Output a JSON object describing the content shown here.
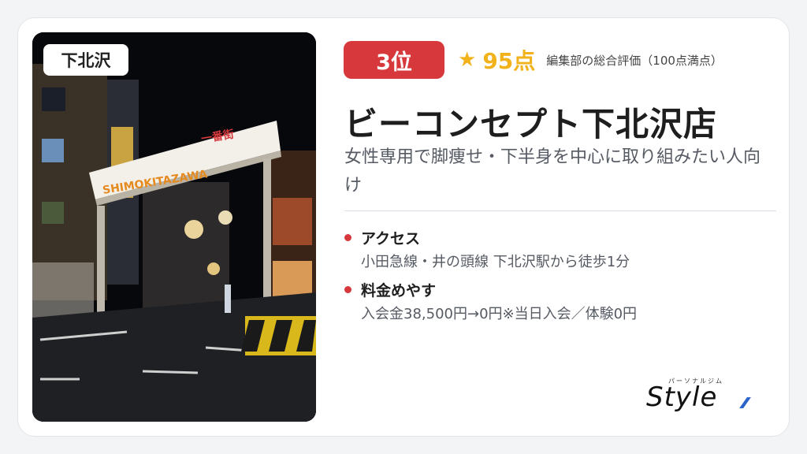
{
  "card": {
    "area_tag": "下北沢",
    "rank_label": "3位",
    "score_label": "95点",
    "score_note": "編集部の総合評価（100点満点）",
    "shop_name": "ビーコンセプト下北沢店",
    "subtitle": "女性専用で脚痩せ・下半身を中心に取り組みたい人向け",
    "photo_sign": "SHIMOKITAZAWA",
    "photo_sign_small": "一番街",
    "info": [
      {
        "title": "アクセス",
        "body": "小田急線・井の頭線 下北沢駅から徒歩1分"
      },
      {
        "title": "料金めやす",
        "body": "入会金38,500円→0円※当日入会／体験0円"
      }
    ]
  },
  "logo": {
    "kana": "パーソナルジム",
    "main": "Style"
  },
  "colors": {
    "accent_red": "#d6383b",
    "star_gold": "#f2b21b",
    "logo_slash": "#2b63c9"
  },
  "icons": {
    "star": "star-icon",
    "bullet": "dot-icon"
  }
}
